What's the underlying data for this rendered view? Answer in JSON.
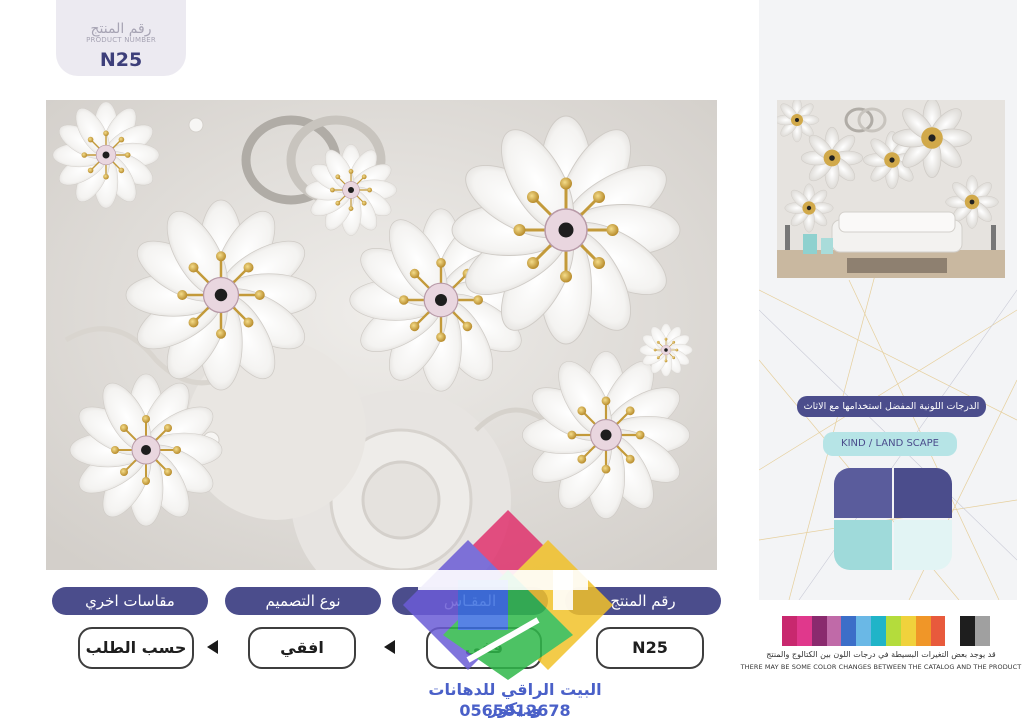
{
  "product_tab": {
    "label_ar": "رقم المنتج",
    "label_en": "PRODUCT NUMBER",
    "code": "N25"
  },
  "specs": {
    "other_sizes_label": "مقاسات اخري",
    "other_sizes_value": "حسب الطلب",
    "design_type_label": "نوع التصميم",
    "design_type_value": "افقي",
    "size_label": "المقـاس",
    "size_value": "قفي",
    "product_number_label": "رقم المنتج",
    "product_number_value": "N25"
  },
  "side_panel": {
    "preferred_colors_text": "الدرجات اللونية المفضل استخدامها مع الاثاث",
    "kind_text": "KIND / LAND SCAPE",
    "swatch_colors": [
      "#5a5c9c",
      "#4b4d8c",
      "#9fdada",
      "#e2f4f4"
    ]
  },
  "color_strip": {
    "colors": [
      "#c8286e",
      "#e0388c",
      "#8a2a6e",
      "#c06aa8",
      "#3c6ec8",
      "#6ab8e6",
      "#20b4c8",
      "#b4dc3c",
      "#f0d23c",
      "#f09628",
      "#e85a3c",
      "#ffffff",
      "#1e1e1e",
      "#a0a0a0"
    ]
  },
  "disclaimer": {
    "arabic": "قد يوجد بعض التغيرات البسيطة في درجات اللون بين الكتالوج والمنتج",
    "english": "THERE MAY BE SOME COLOR CHANGES BETWEEN THE CATALOG AND THE PRODUCT"
  },
  "watermark": {
    "company": "البيت الراقي للدهانات وديكور",
    "phone": "0565812678"
  }
}
